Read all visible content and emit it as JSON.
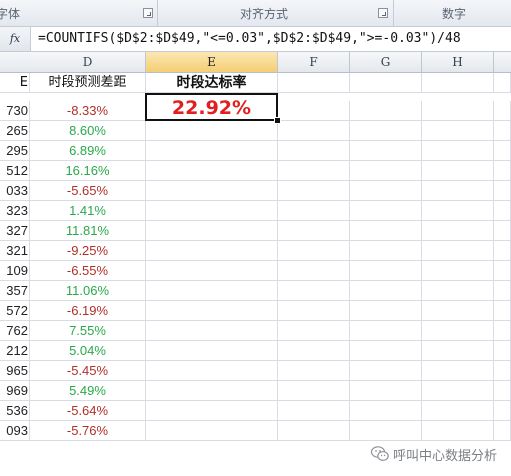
{
  "ribbon": {
    "groups": [
      {
        "label": "字体"
      },
      {
        "label": "对齐方式"
      },
      {
        "label": "数字"
      }
    ]
  },
  "formula_bar": {
    "fx_label": "fx",
    "formula": "=COUNTIFS($D$2:$D$49,\"<=0.03\",$D$2:$D$49,\">=-0.03\")/48"
  },
  "columns": [
    "D",
    "E",
    "F",
    "G",
    "H"
  ],
  "header_row": {
    "a_partial": "E",
    "d": "时段预测差距",
    "e": "时段达标率"
  },
  "result": {
    "value": "22.92%",
    "color": "#e11f1f"
  },
  "rows": [
    {
      "a": "730",
      "d": "-8.33%",
      "sign": "neg"
    },
    {
      "a": "265",
      "d": "8.60%",
      "sign": "pos"
    },
    {
      "a": "295",
      "d": "6.89%",
      "sign": "pos"
    },
    {
      "a": "512",
      "d": "16.16%",
      "sign": "pos"
    },
    {
      "a": "033",
      "d": "-5.65%",
      "sign": "neg"
    },
    {
      "a": "323",
      "d": "1.41%",
      "sign": "pos"
    },
    {
      "a": "327",
      "d": "11.81%",
      "sign": "pos"
    },
    {
      "a": "321",
      "d": "-9.25%",
      "sign": "neg"
    },
    {
      "a": "109",
      "d": "-6.55%",
      "sign": "neg"
    },
    {
      "a": "357",
      "d": "11.06%",
      "sign": "pos"
    },
    {
      "a": "572",
      "d": "-6.19%",
      "sign": "neg"
    },
    {
      "a": "762",
      "d": "7.55%",
      "sign": "pos"
    },
    {
      "a": "212",
      "d": "5.04%",
      "sign": "pos"
    },
    {
      "a": "965",
      "d": "-5.45%",
      "sign": "neg"
    },
    {
      "a": "969",
      "d": "5.49%",
      "sign": "pos"
    },
    {
      "a": "536",
      "d": "-5.64%",
      "sign": "neg"
    },
    {
      "a": "093",
      "d": "-5.76%",
      "sign": "neg"
    }
  ],
  "colors": {
    "positive": "#2aa84b",
    "negative": "#b0302a",
    "selected_header": "#f4cf73"
  },
  "watermark": {
    "text": "呼叫中心数据分析",
    "icon": "wechat-icon"
  }
}
